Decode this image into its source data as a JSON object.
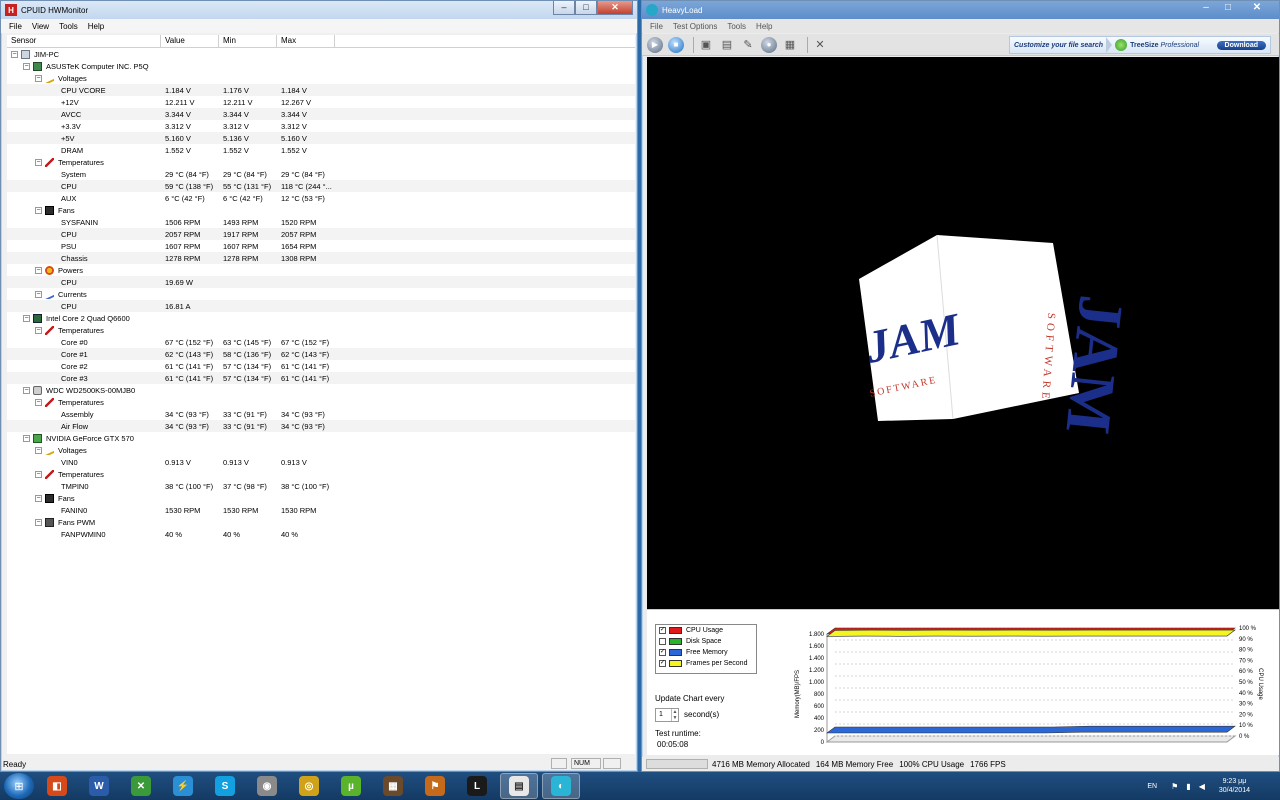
{
  "hwm": {
    "title": "CPUID HWMonitor",
    "menu": [
      "File",
      "View",
      "Tools",
      "Help"
    ],
    "columns": [
      "Sensor",
      "Value",
      "Min",
      "Max"
    ],
    "rows": [
      {
        "d": 0,
        "icon": "pc",
        "name": "JIM-PC",
        "v": "",
        "mn": "",
        "mx": ""
      },
      {
        "d": 1,
        "icon": "board",
        "name": "ASUSTeK Computer INC. P5Q",
        "v": "",
        "mn": "",
        "mx": ""
      },
      {
        "d": 2,
        "icon": "volt",
        "name": "Voltages",
        "v": "",
        "mn": "",
        "mx": ""
      },
      {
        "d": 3,
        "name": "CPU VCORE",
        "v": "1.184 V",
        "mn": "1.176 V",
        "mx": "1.184 V"
      },
      {
        "d": 3,
        "name": "+12V",
        "v": "12.211 V",
        "mn": "12.211 V",
        "mx": "12.267 V"
      },
      {
        "d": 3,
        "name": "AVCC",
        "v": "3.344 V",
        "mn": "3.344 V",
        "mx": "3.344 V"
      },
      {
        "d": 3,
        "name": "+3.3V",
        "v": "3.312 V",
        "mn": "3.312 V",
        "mx": "3.312 V"
      },
      {
        "d": 3,
        "name": "+5V",
        "v": "5.160 V",
        "mn": "5.136 V",
        "mx": "5.160 V"
      },
      {
        "d": 3,
        "name": "DRAM",
        "v": "1.552 V",
        "mn": "1.552 V",
        "mx": "1.552 V"
      },
      {
        "d": 2,
        "icon": "temp",
        "name": "Temperatures",
        "v": "",
        "mn": "",
        "mx": ""
      },
      {
        "d": 3,
        "name": "System",
        "v": "29 °C  (84 °F)",
        "mn": "29 °C  (84 °F)",
        "mx": "29 °C  (84 °F)"
      },
      {
        "d": 3,
        "name": "CPU",
        "v": "59 °C  (138 °F)",
        "mn": "55 °C  (131 °F)",
        "mx": "118 °C  (244 °..."
      },
      {
        "d": 3,
        "name": "AUX",
        "v": "6 °C  (42 °F)",
        "mn": "6 °C  (42 °F)",
        "mx": "12 °C  (53 °F)"
      },
      {
        "d": 2,
        "icon": "fan",
        "name": "Fans",
        "v": "",
        "mn": "",
        "mx": ""
      },
      {
        "d": 3,
        "name": "SYSFANIN",
        "v": "1506 RPM",
        "mn": "1493 RPM",
        "mx": "1520 RPM"
      },
      {
        "d": 3,
        "name": "CPU",
        "v": "2057 RPM",
        "mn": "1917 RPM",
        "mx": "2057 RPM"
      },
      {
        "d": 3,
        "name": "PSU",
        "v": "1607 RPM",
        "mn": "1607 RPM",
        "mx": "1654 RPM"
      },
      {
        "d": 3,
        "name": "Chassis",
        "v": "1278 RPM",
        "mn": "1278 RPM",
        "mx": "1308 RPM"
      },
      {
        "d": 2,
        "icon": "power",
        "name": "Powers",
        "v": "",
        "mn": "",
        "mx": ""
      },
      {
        "d": 3,
        "name": "CPU",
        "v": "19.69 W",
        "mn": "",
        "mx": ""
      },
      {
        "d": 2,
        "icon": "cur",
        "name": "Currents",
        "v": "",
        "mn": "",
        "mx": ""
      },
      {
        "d": 3,
        "name": "CPU",
        "v": "16.81 A",
        "mn": "",
        "mx": ""
      },
      {
        "d": 1,
        "icon": "cpu",
        "name": "Intel Core 2 Quad Q6600",
        "v": "",
        "mn": "",
        "mx": ""
      },
      {
        "d": 2,
        "icon": "temp",
        "name": "Temperatures",
        "v": "",
        "mn": "",
        "mx": ""
      },
      {
        "d": 3,
        "name": "Core #0",
        "v": "67 °C  (152 °F)",
        "mn": "63 °C  (145 °F)",
        "mx": "67 °C  (152 °F)"
      },
      {
        "d": 3,
        "name": "Core #1",
        "v": "62 °C  (143 °F)",
        "mn": "58 °C  (136 °F)",
        "mx": "62 °C  (143 °F)"
      },
      {
        "d": 3,
        "name": "Core #2",
        "v": "61 °C  (141 °F)",
        "mn": "57 °C  (134 °F)",
        "mx": "61 °C  (141 °F)"
      },
      {
        "d": 3,
        "name": "Core #3",
        "v": "61 °C  (141 °F)",
        "mn": "57 °C  (134 °F)",
        "mx": "61 °C  (141 °F)"
      },
      {
        "d": 1,
        "icon": "disk",
        "name": "WDC WD2500KS-00MJB0",
        "v": "",
        "mn": "",
        "mx": ""
      },
      {
        "d": 2,
        "icon": "temp",
        "name": "Temperatures",
        "v": "",
        "mn": "",
        "mx": ""
      },
      {
        "d": 3,
        "name": "Assembly",
        "v": "34 °C  (93 °F)",
        "mn": "33 °C  (91 °F)",
        "mx": "34 °C  (93 °F)"
      },
      {
        "d": 3,
        "name": "Air Flow",
        "v": "34 °C  (93 °F)",
        "mn": "33 °C  (91 °F)",
        "mx": "34 °C  (93 °F)"
      },
      {
        "d": 1,
        "icon": "gpu",
        "name": "NVIDIA GeForce GTX 570",
        "v": "",
        "mn": "",
        "mx": ""
      },
      {
        "d": 2,
        "icon": "volt",
        "name": "Voltages",
        "v": "",
        "mn": "",
        "mx": ""
      },
      {
        "d": 3,
        "name": "VIN0",
        "v": "0.913 V",
        "mn": "0.913 V",
        "mx": "0.913 V"
      },
      {
        "d": 2,
        "icon": "temp",
        "name": "Temperatures",
        "v": "",
        "mn": "",
        "mx": ""
      },
      {
        "d": 3,
        "name": "TMPIN0",
        "v": "38 °C  (100 °F)",
        "mn": "37 °C  (98 °F)",
        "mx": "38 °C  (100 °F)"
      },
      {
        "d": 2,
        "icon": "fan",
        "name": "Fans",
        "v": "",
        "mn": "",
        "mx": ""
      },
      {
        "d": 3,
        "name": "FANIN0",
        "v": "1530 RPM",
        "mn": "1530 RPM",
        "mx": "1530 RPM"
      },
      {
        "d": 2,
        "icon": "pwm",
        "name": "Fans PWM",
        "v": "",
        "mn": "",
        "mx": ""
      },
      {
        "d": 3,
        "name": "FANPWMIN0",
        "v": "40 %",
        "mn": "40 %",
        "mx": "40 %"
      }
    ],
    "status": "Ready",
    "status_num": "NUM"
  },
  "hl": {
    "title": "HeavyLoad",
    "menu": [
      "File",
      "Test Options",
      "Tools",
      "Help"
    ],
    "ad": {
      "customize": "Customize your file search",
      "product": "TreeSize",
      "edition": "Professional",
      "download": "Download"
    },
    "legend": [
      {
        "label": "CPU Usage",
        "checked": true,
        "color": "#e01a1a"
      },
      {
        "label": "Disk Space",
        "checked": false,
        "color": "#27b32a"
      },
      {
        "label": "Free Memory",
        "checked": true,
        "color": "#2b67d6"
      },
      {
        "label": "Frames per Second",
        "checked": true,
        "color": "#f4f41e"
      }
    ],
    "update_label": "Update Chart every",
    "update_value": "1",
    "update_unit": "second(s)",
    "runtime_label": "Test runtime:",
    "runtime_value": "00:05:08",
    "status": {
      "allocated": "4716 MB Memory Allocated",
      "free": "164 MB Memory Free",
      "cpu": "100% CPU Usage",
      "fps": "1766 FPS"
    }
  },
  "chart_data": {
    "type": "area",
    "ylabel": "Memory(MB)/FPS",
    "y2label": "CPU Usage",
    "ylim": [
      0,
      1000
    ],
    "y2lim": [
      0,
      100
    ],
    "y_ticks": [
      "0",
      "200",
      "400",
      "600",
      "800",
      "1.000",
      "1.200",
      "1.400",
      "1.600",
      "1.800"
    ],
    "y2_ticks": [
      "0 %",
      "10 %",
      "20 %",
      "30 %",
      "40 %",
      "50 %",
      "60 %",
      "70 %",
      "80 %",
      "90 %",
      "100 %"
    ],
    "series": [
      {
        "name": "CPU Usage",
        "color": "#e01a1a",
        "axis": "y2",
        "values": [
          100,
          100,
          100,
          100,
          100,
          100,
          100,
          100,
          100,
          100,
          100,
          100
        ]
      },
      {
        "name": "Frames per Second",
        "color": "#f4f41e",
        "axis": "y",
        "values": [
          1760,
          1765,
          1762,
          1766,
          1764,
          1766,
          1763,
          1766,
          1765,
          1766,
          1766,
          1766
        ]
      },
      {
        "name": "Free Memory",
        "color": "#2b67d6",
        "axis": "y",
        "values": [
          150,
          150,
          150,
          150,
          150,
          150,
          150,
          164,
          164,
          164,
          164,
          164
        ]
      }
    ]
  },
  "cube": {
    "front_text": "JAM",
    "front_sub": "SOFTWARE",
    "side_text": "JAM",
    "side_sub": "SOFTWARE"
  },
  "taskbar": {
    "lang": "EN",
    "time": "9:23 μμ",
    "date": "30/4/2014",
    "apps": [
      {
        "name": "explorer-app",
        "color": "#d64a1a",
        "glyph": "◧"
      },
      {
        "name": "word-app",
        "color": "#2b5caa",
        "glyph": "W"
      },
      {
        "name": "xbox-app",
        "color": "#3a9a3a",
        "glyph": "✕"
      },
      {
        "name": "bolt-app",
        "color": "#2b8fd6",
        "glyph": "⚡"
      },
      {
        "name": "skype-app",
        "color": "#13a0e0",
        "glyph": "S"
      },
      {
        "name": "webcam-app",
        "color": "#8a8a8a",
        "glyph": "◉"
      },
      {
        "name": "chrome-app",
        "color": "#d0a21a",
        "glyph": "◎"
      },
      {
        "name": "utorrent-app",
        "color": "#59b42c",
        "glyph": "µ"
      },
      {
        "name": "game-app",
        "color": "#6a4a2a",
        "glyph": "▦"
      },
      {
        "name": "broom-app",
        "color": "#c46a1a",
        "glyph": "⚑"
      },
      {
        "name": "league-app",
        "color": "#1a1a1a",
        "glyph": "L"
      },
      {
        "name": "hwmonitor-app",
        "color": "#e8e8e8",
        "glyph": "▤"
      },
      {
        "name": "heavyload-app",
        "color": "#2ab5d6",
        "glyph": "◐"
      }
    ]
  }
}
